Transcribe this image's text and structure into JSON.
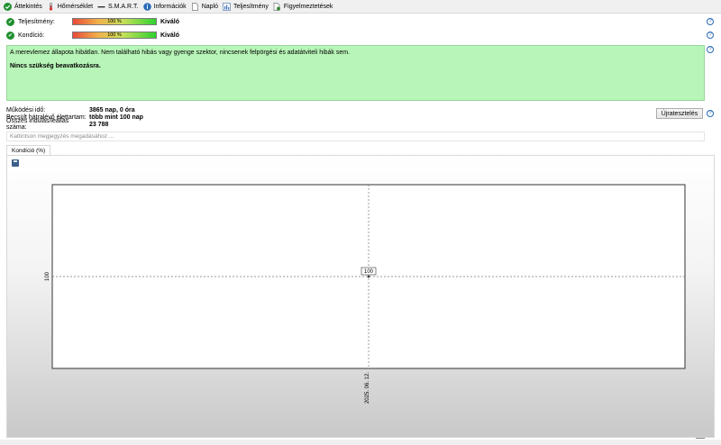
{
  "toolbar": {
    "tabs": [
      {
        "label": "Áttekintés",
        "icon": "check-circle-icon"
      },
      {
        "label": "Hőmérséklet",
        "icon": "thermometer-icon"
      },
      {
        "label": "S.M.A.R.T.",
        "icon": "dash-icon"
      },
      {
        "label": "Információk",
        "icon": "info-icon"
      },
      {
        "label": "Napló",
        "icon": "document-icon"
      },
      {
        "label": "Teljesítmény",
        "icon": "performance-chart-icon"
      },
      {
        "label": "Figyelmeztetések",
        "icon": "warnings-document-icon"
      }
    ]
  },
  "status": {
    "performance": {
      "label": "Teljesítmény:",
      "bar_text": "100 %",
      "value": 100,
      "rating": "Kiváló"
    },
    "condition": {
      "label": "Kondíció:",
      "bar_text": "100 %",
      "value": 100,
      "rating": "Kiváló"
    }
  },
  "info": {
    "message": "A merevlemez állapota hibátlan. Nem található hibás vagy gyenge szektor, nincsenek felpörgési és adatátviteli hibák sem.",
    "action": "Nincs szükség beavatkozásra."
  },
  "stats": {
    "uptime_label": "Működési idő:",
    "uptime_value": "3865 nap, 0 óra",
    "lifetime_label": "Becsült hátralévő élettartam:",
    "lifetime_value": "több mint 100 nap",
    "starts_label": "Összes indulás/leállás száma:",
    "starts_value": "23 788"
  },
  "retest_label": "Újratesztelés",
  "note_placeholder": "Kattintson megjegyzés megadásához ...",
  "chart_tab_label": "Kondíció  (%)",
  "colors": {
    "info_bg": "#b8f5b8",
    "ok_green": "#1f8f2f",
    "help_blue": "#2a6ab8"
  },
  "chart_data": {
    "type": "line",
    "x": [
      "2025. 06. 12."
    ],
    "series": [
      {
        "values": [
          100
        ]
      }
    ],
    "point_label": "100",
    "y_tick": "100",
    "x_tick": "2025. 06. 12.",
    "grid": true
  }
}
